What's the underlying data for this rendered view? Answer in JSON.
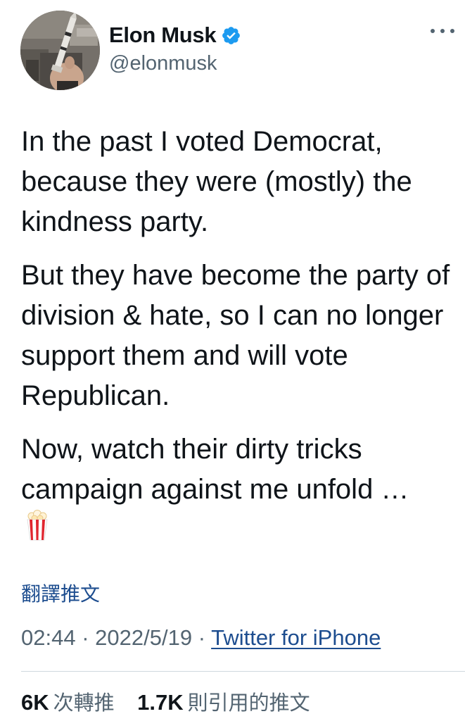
{
  "author": {
    "display_name": "Elon Musk",
    "handle": "@elonmusk",
    "verified": true,
    "avatar_icon": "profile-photo-rocket-model"
  },
  "more_icon": "more-horizontal-icon",
  "tweet": {
    "paragraphs": [
      "In the past I voted Democrat, because they were (mostly) the kindness party.",
      "But they have become the party of division & hate, so I can no longer support them and will vote Republican.",
      "Now, watch their dirty tricks campaign against me unfold …"
    ],
    "emoji": "🍿",
    "translate_label": "翻譯推文",
    "time": "02:44",
    "separator": "·",
    "date": "2022/5/19",
    "source": "Twitter for iPhone"
  },
  "stats": {
    "retweets_count": "6K",
    "retweets_label": "次轉推",
    "quotes_count": "1.7K",
    "quotes_label": "則引用的推文"
  },
  "colors": {
    "text": "#0f1419",
    "secondary": "#536471",
    "link": "#1d4d8f",
    "verified": "#1d9bf0",
    "divider": "#cfd9de"
  }
}
